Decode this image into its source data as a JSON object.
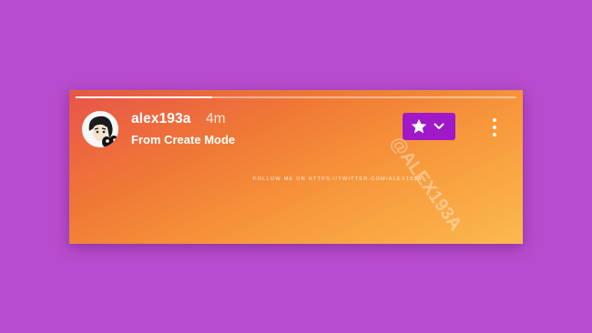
{
  "story": {
    "progress": 0.31,
    "username": "alex193a",
    "timestamp": "4m",
    "subtitle": "From Create Mode",
    "caption": "FOLLOW ME ON HTTPS://TWITTER.COM/ALEX193A",
    "watermark": "@ALEX193A",
    "avatar_icon": "anime-character-avatar",
    "close_friends_icon": "star-icon",
    "menu_icon": "more-vertical-icon"
  },
  "colors": {
    "background": "#b84cce",
    "card_gradient_start": "#e8544a",
    "card_gradient_end": "#fbb94f",
    "close_friends_button": "#a019c8",
    "text": "#ffffff"
  }
}
